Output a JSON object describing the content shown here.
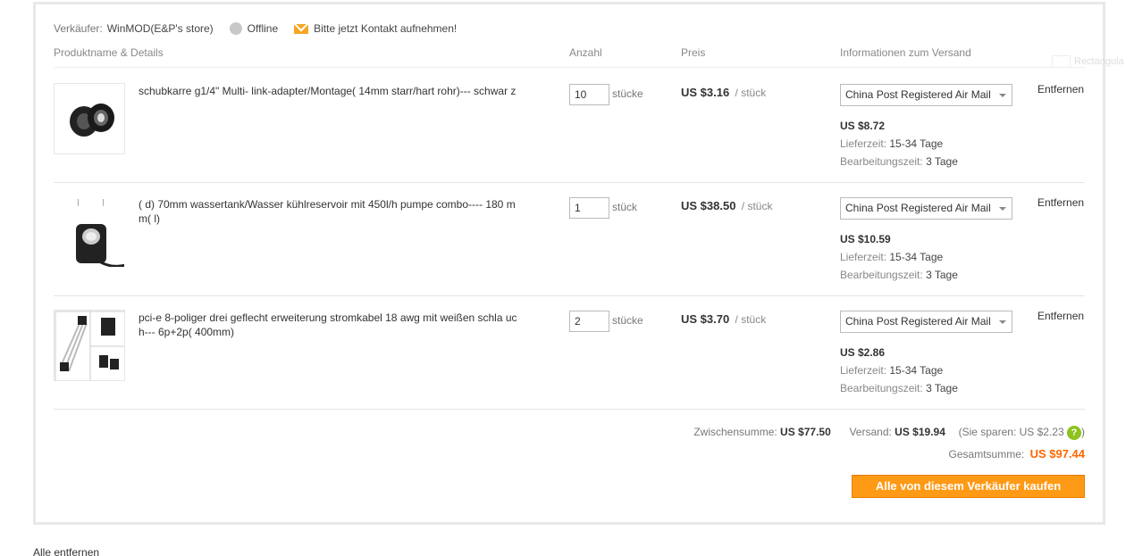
{
  "seller": {
    "label": "Verkäufer:",
    "name": "WinMOD(E&P's store)",
    "status": "Offline",
    "contact": "Bitte jetzt Kontakt aufnehmen!"
  },
  "columns": {
    "product": "Produktname & Details",
    "qty": "Anzahl",
    "price": "Preis",
    "shipping": "Informationen zum Versand"
  },
  "items": [
    {
      "name": "schubkarre g1/4\" Multi- link-adapter/Montage( 14mm starr/hart rohr)--- schwar z",
      "qty": "10",
      "unit": "stücke",
      "price": "US $3.16",
      "per": "/ stück",
      "shipping_method": "China Post Registered Air Mail",
      "shipping_cost": "US $8.72",
      "delivery_label": "Lieferzeit:",
      "delivery_value": "15-34 Tage",
      "processing_label": "Bearbeitungszeit:",
      "processing_value": "3 Tage",
      "remove": "Entfernen"
    },
    {
      "name": "( d) 70mm wassertank/Wasser kühlreservoir mit 450l/h pumpe combo---- 180 mm( l)",
      "qty": "1",
      "unit": "stück",
      "price": "US $38.50",
      "per": "/ stück",
      "shipping_method": "China Post Registered Air Mail",
      "shipping_cost": "US $10.59",
      "delivery_label": "Lieferzeit:",
      "delivery_value": "15-34 Tage",
      "processing_label": "Bearbeitungszeit:",
      "processing_value": "3 Tage",
      "remove": "Entfernen"
    },
    {
      "name": "pci-e 8-poliger drei geflecht erweiterung stromkabel 18 awg mit weißen schla uch--- 6p+2p( 400mm)",
      "qty": "2",
      "unit": "stücke",
      "price": "US $3.70",
      "per": "/ stück",
      "shipping_method": "China Post Registered Air Mail",
      "shipping_cost": "US $2.86",
      "delivery_label": "Lieferzeit:",
      "delivery_value": "15-34 Tage",
      "processing_label": "Bearbeitungszeit:",
      "processing_value": "3 Tage",
      "remove": "Entfernen"
    }
  ],
  "totals": {
    "subtotal_label": "Zwischensumme:",
    "subtotal": "US $77.50",
    "shipping_label": "Versand:",
    "shipping": "US $19.94",
    "savings": "(Sie sparen: US $2.23",
    "savings_close": ")",
    "help_glyph": "?",
    "grand_label": "Gesamtsumme:",
    "grand": "US $97.44"
  },
  "buy_button": "Alle von diesem Verkäufer kaufen",
  "remove_all": "Alle entfernen",
  "ghost_label": "Rectangula",
  "colors": {
    "accent_orange": "#ff9a16",
    "total_orange": "#ff6600",
    "help_green": "#8dc21f"
  }
}
